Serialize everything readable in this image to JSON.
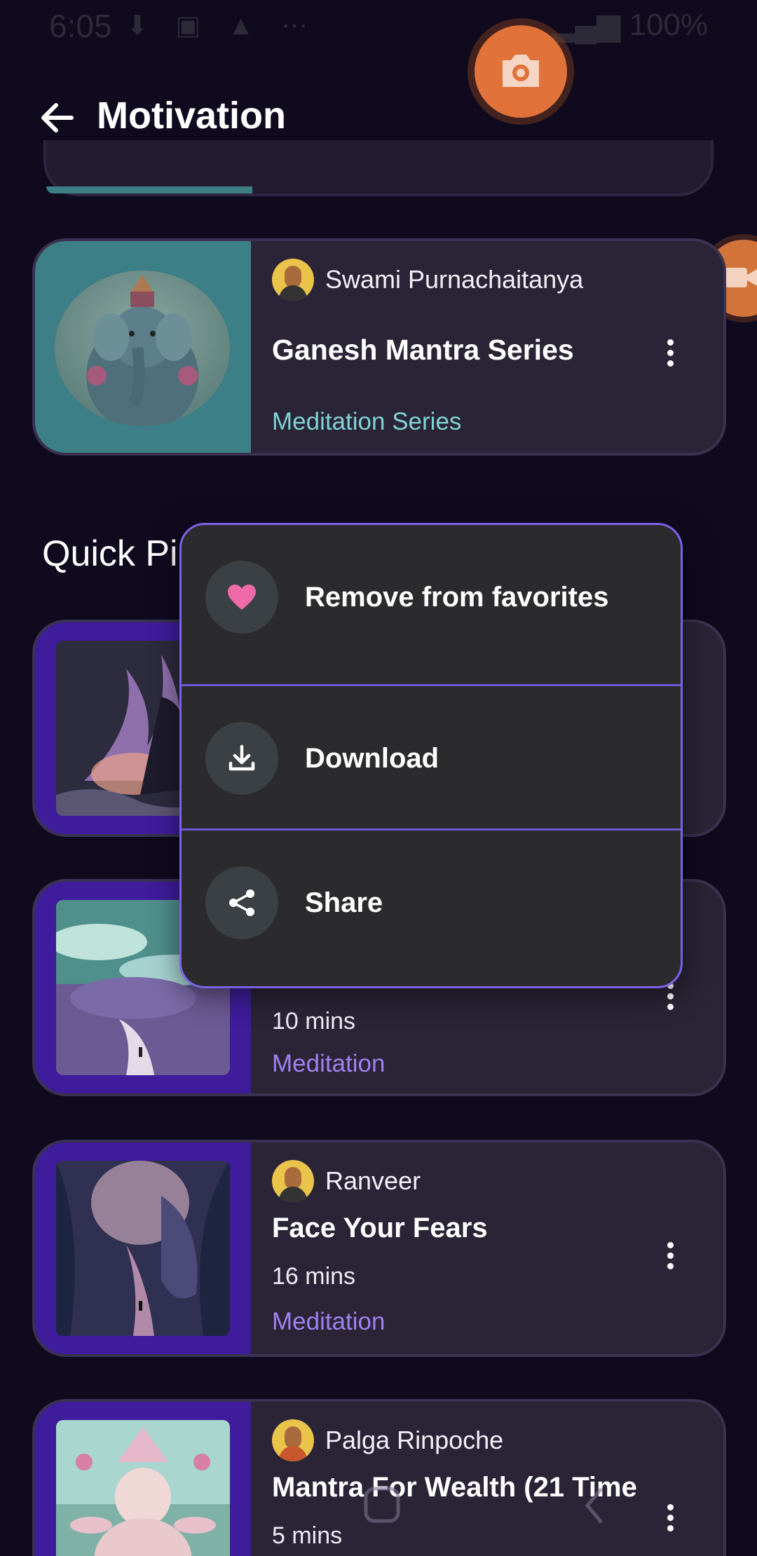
{
  "status_bar": {
    "time": "6:05",
    "battery": "100%"
  },
  "header": {
    "title": "Motivation"
  },
  "series_card": {
    "author": "Swami Purnachaitanya",
    "title": "Ganesh Mantra Series",
    "category": "Meditation Series"
  },
  "section": {
    "title": "Quick Pi"
  },
  "menu": {
    "items": [
      {
        "label": "Remove from favorites",
        "icon": "heart-icon"
      },
      {
        "label": "Download",
        "icon": "download-icon"
      },
      {
        "label": "Share",
        "icon": "share-icon"
      }
    ]
  },
  "cards": [
    {
      "author": "",
      "title": "",
      "duration": "",
      "category": ""
    },
    {
      "author": "",
      "title": "",
      "duration": "10 mins",
      "category": "Meditation"
    },
    {
      "author": "Ranveer",
      "title": "Face Your Fears",
      "duration": "16 mins",
      "category": "Meditation"
    },
    {
      "author": "Palga Rinpoche",
      "title": "Mantra For Wealth (21 Time",
      "duration": "5 mins",
      "category": ""
    }
  ],
  "colors": {
    "background": "#100a1f",
    "card": "#2a2436",
    "accent_purple": "#9e83f0",
    "accent_teal": "#7fd3d6",
    "popup_border": "#7a62e8",
    "heart": "#f06aa9"
  }
}
